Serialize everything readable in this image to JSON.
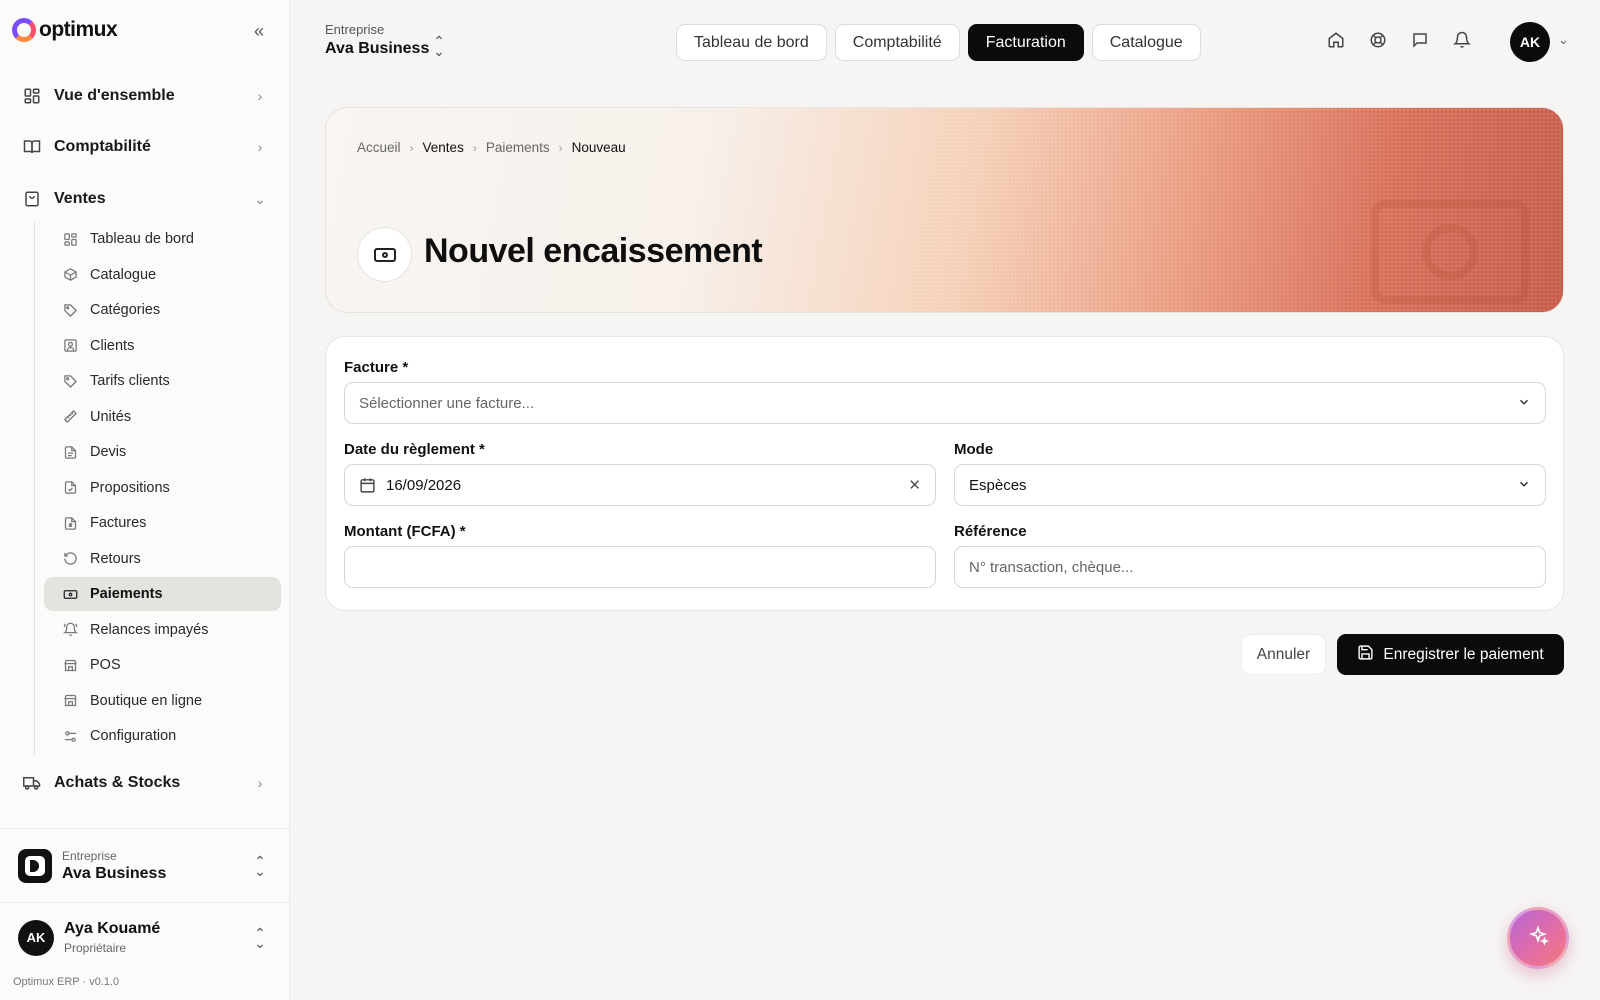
{
  "app": {
    "logo_text": "optimux",
    "version": "Optimux ERP · v0.1.0"
  },
  "sidebar": {
    "sections": [
      {
        "label": "Vue d'ensemble",
        "icon": "grid-icon",
        "state": "collapsed"
      },
      {
        "label": "Comptabilité",
        "icon": "book-icon",
        "state": "collapsed"
      },
      {
        "label": "Ventes",
        "icon": "shopping-bag-icon",
        "state": "expanded"
      }
    ],
    "ventes_items": [
      {
        "label": "Tableau de bord",
        "icon": "grid-icon"
      },
      {
        "label": "Catalogue",
        "icon": "package-icon"
      },
      {
        "label": "Catégories",
        "icon": "tag-icon"
      },
      {
        "label": "Clients",
        "icon": "contact-icon"
      },
      {
        "label": "Tarifs clients",
        "icon": "tag-icon"
      },
      {
        "label": "Unités",
        "icon": "ruler-icon"
      },
      {
        "label": "Devis",
        "icon": "file-text-icon"
      },
      {
        "label": "Propositions",
        "icon": "file-check-icon"
      },
      {
        "label": "Factures",
        "icon": "receipt-icon"
      },
      {
        "label": "Retours",
        "icon": "undo-icon"
      },
      {
        "label": "Paiements",
        "icon": "banknote-icon",
        "active": true
      },
      {
        "label": "Relances impayés",
        "icon": "bell-ring-icon"
      },
      {
        "label": "POS",
        "icon": "store-icon"
      },
      {
        "label": "Boutique en ligne",
        "icon": "store-icon"
      },
      {
        "label": "Configuration",
        "icon": "settings-sliders-icon"
      }
    ],
    "achats": {
      "label": "Achats & Stocks",
      "icon": "truck-icon"
    },
    "company": {
      "caption": "Entreprise",
      "name": "Ava Business"
    },
    "user": {
      "initials": "AK",
      "name": "Aya Kouamé",
      "role": "Propriétaire"
    }
  },
  "topbar": {
    "company_caption": "Entreprise",
    "company_name": "Ava Business",
    "tabs": [
      {
        "label": "Tableau de bord"
      },
      {
        "label": "Comptabilité"
      },
      {
        "label": "Facturation",
        "active": true
      },
      {
        "label": "Catalogue"
      }
    ],
    "icons": [
      "home-icon",
      "help-circle-icon",
      "message-icon",
      "bell-icon"
    ],
    "avatar_initials": "AK"
  },
  "hero": {
    "breadcrumb": [
      "Accueil",
      "Ventes",
      "Paiements",
      "Nouveau"
    ],
    "title": "Nouvel encaissement",
    "icon": "banknote-icon"
  },
  "form": {
    "facture": {
      "label": "Facture *",
      "placeholder": "Sélectionner une facture..."
    },
    "date": {
      "label": "Date du règlement *",
      "value": "16/09/2026"
    },
    "mode": {
      "label": "Mode",
      "value": "Espèces"
    },
    "montant": {
      "label": "Montant (FCFA) *",
      "value": ""
    },
    "reference": {
      "label": "Référence",
      "placeholder": "N° transaction, chèque..."
    }
  },
  "actions": {
    "cancel_label": "Annuler",
    "save_label": "Enregistrer le paiement"
  },
  "colors": {
    "primary": "#0b0b0b",
    "background": "#f6f5f3",
    "hero_accent": "#d8705a",
    "fab_gradient_start": "#b565d6",
    "fab_gradient_end": "#f07a7a"
  }
}
